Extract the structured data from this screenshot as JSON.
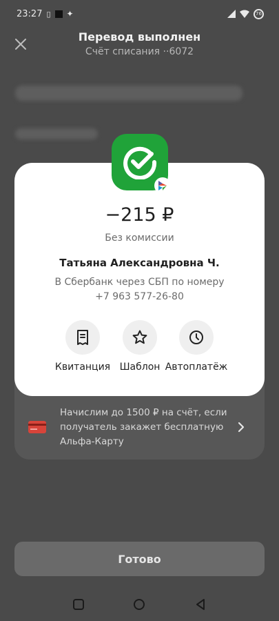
{
  "status_bar": {
    "time": "23:27",
    "battery_level": "76"
  },
  "header": {
    "title": "Перевод выполнен",
    "subtitle": "Счёт списания ··6072"
  },
  "receipt": {
    "amount": "−215 ₽",
    "commission": "Без комиссии",
    "recipient_name": "Татьяна Александровна Ч.",
    "method_line1": "В Сбербанк через СБП по номеру",
    "method_line2": "+7 963 577-26-80",
    "bank_icon": "sberbank-logo",
    "payment_system_icon": "sbp-icon"
  },
  "actions": [
    {
      "label": "Квитанция",
      "icon": "receipt-icon"
    },
    {
      "label": "Шаблон",
      "icon": "star-icon"
    },
    {
      "label": "Автоплатёж",
      "icon": "clock-icon"
    }
  ],
  "promo": {
    "text": "Начислим до 1500 ₽ на счёт, если получатель закажет бесплатную Альфа-Карту",
    "icon": "card-icon"
  },
  "done_button": {
    "label": "Готово"
  },
  "colors": {
    "sber_green": "#20a339",
    "promo_card_red": "#d8443a",
    "overlay": "#4a4a4a"
  }
}
